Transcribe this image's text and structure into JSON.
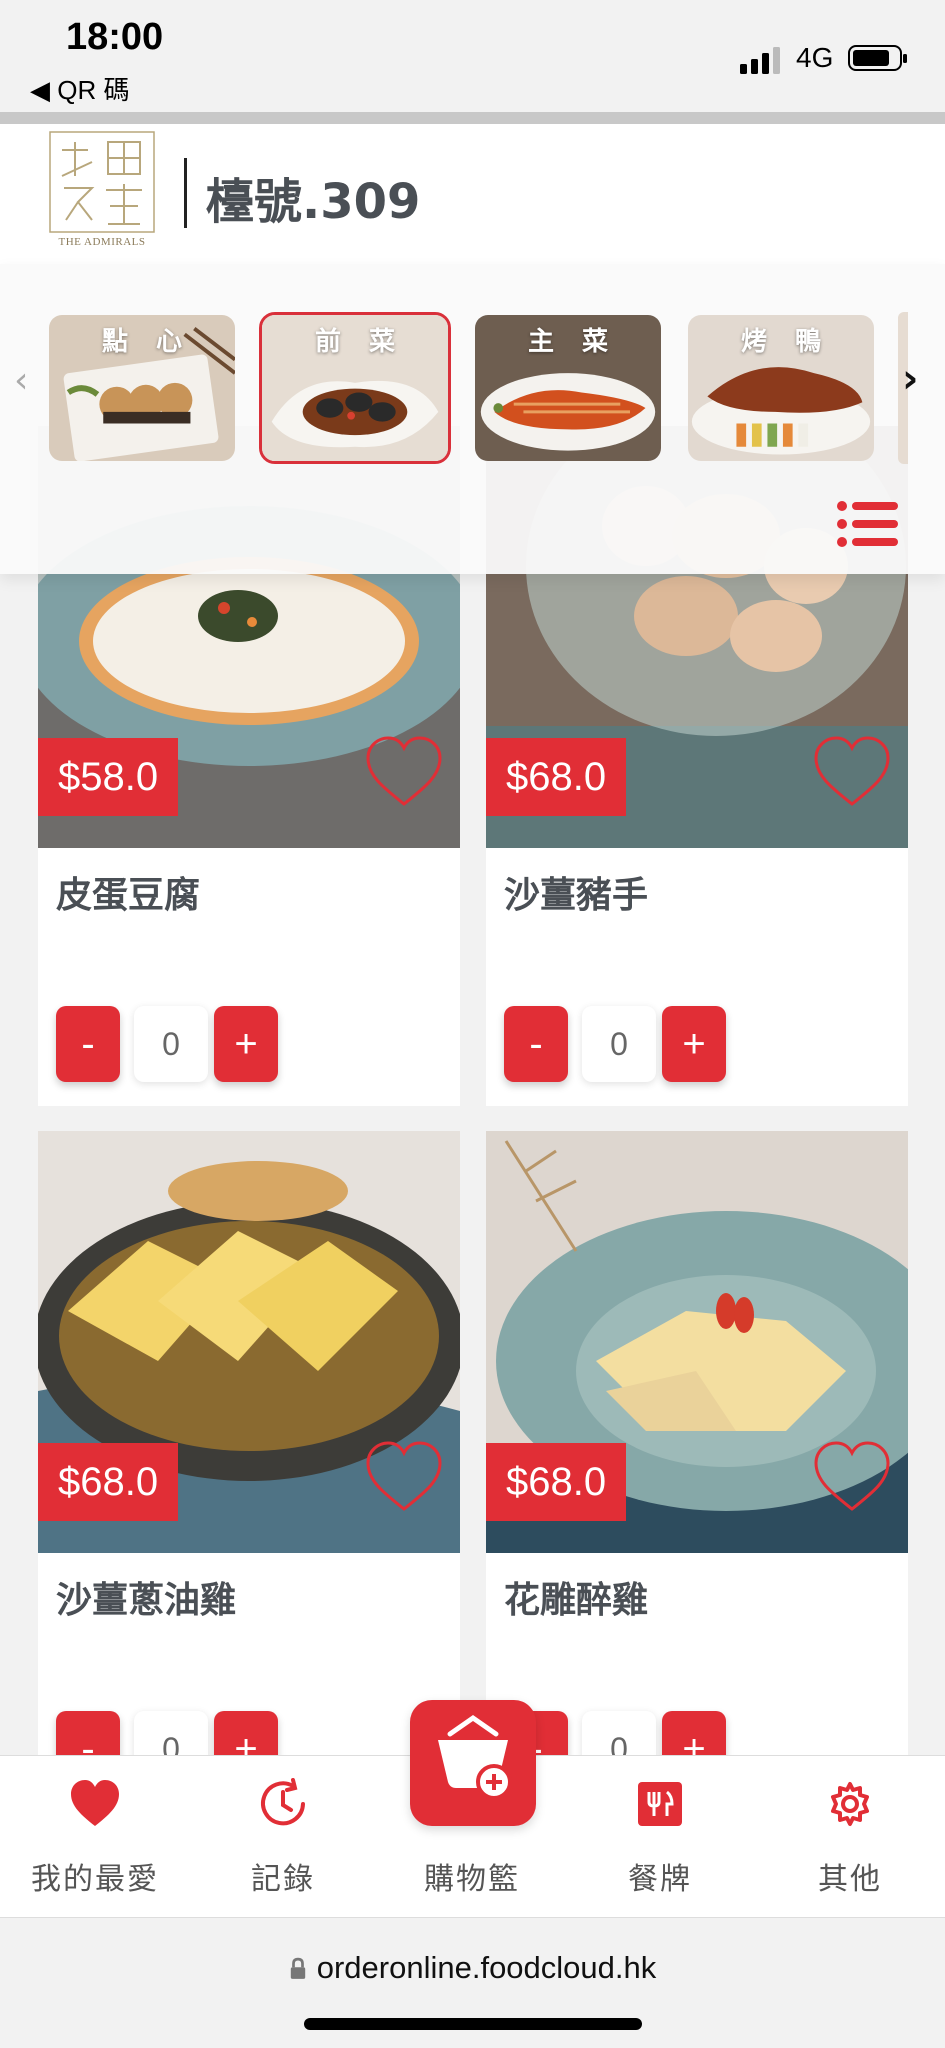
{
  "status_bar": {
    "time": "18:00",
    "back_label": "◀ QR 碼",
    "network": "4G"
  },
  "header": {
    "logo_text": "THE ADMIRALS",
    "table_label": "檯號.309"
  },
  "categories": [
    {
      "label": "點心",
      "active": false
    },
    {
      "label": "前菜",
      "active": true
    },
    {
      "label": "主菜",
      "active": false
    },
    {
      "label": "烤鴨",
      "active": false
    }
  ],
  "products": [
    {
      "name": "皮蛋豆腐",
      "price": "$58.0",
      "qty": "0"
    },
    {
      "name": "沙薑豬手",
      "price": "$68.0",
      "qty": "0"
    },
    {
      "name": "沙薑蔥油雞",
      "price": "$68.0",
      "qty": "0"
    },
    {
      "name": "花雕醉雞",
      "price": "$68.0",
      "qty": "0"
    }
  ],
  "qty_controls": {
    "minus": "-",
    "plus": "+"
  },
  "nav": [
    {
      "label": "我的最愛",
      "icon": "heart-icon"
    },
    {
      "label": "記錄",
      "icon": "clock-icon"
    },
    {
      "label": "購物籃",
      "icon": "basket-icon"
    },
    {
      "label": "餐牌",
      "icon": "menu-icon"
    },
    {
      "label": "其他",
      "icon": "gear-icon"
    }
  ],
  "url": "orderonline.foodcloud.hk",
  "colors": {
    "accent": "#e12e36",
    "title_text": "#4a4f55"
  }
}
